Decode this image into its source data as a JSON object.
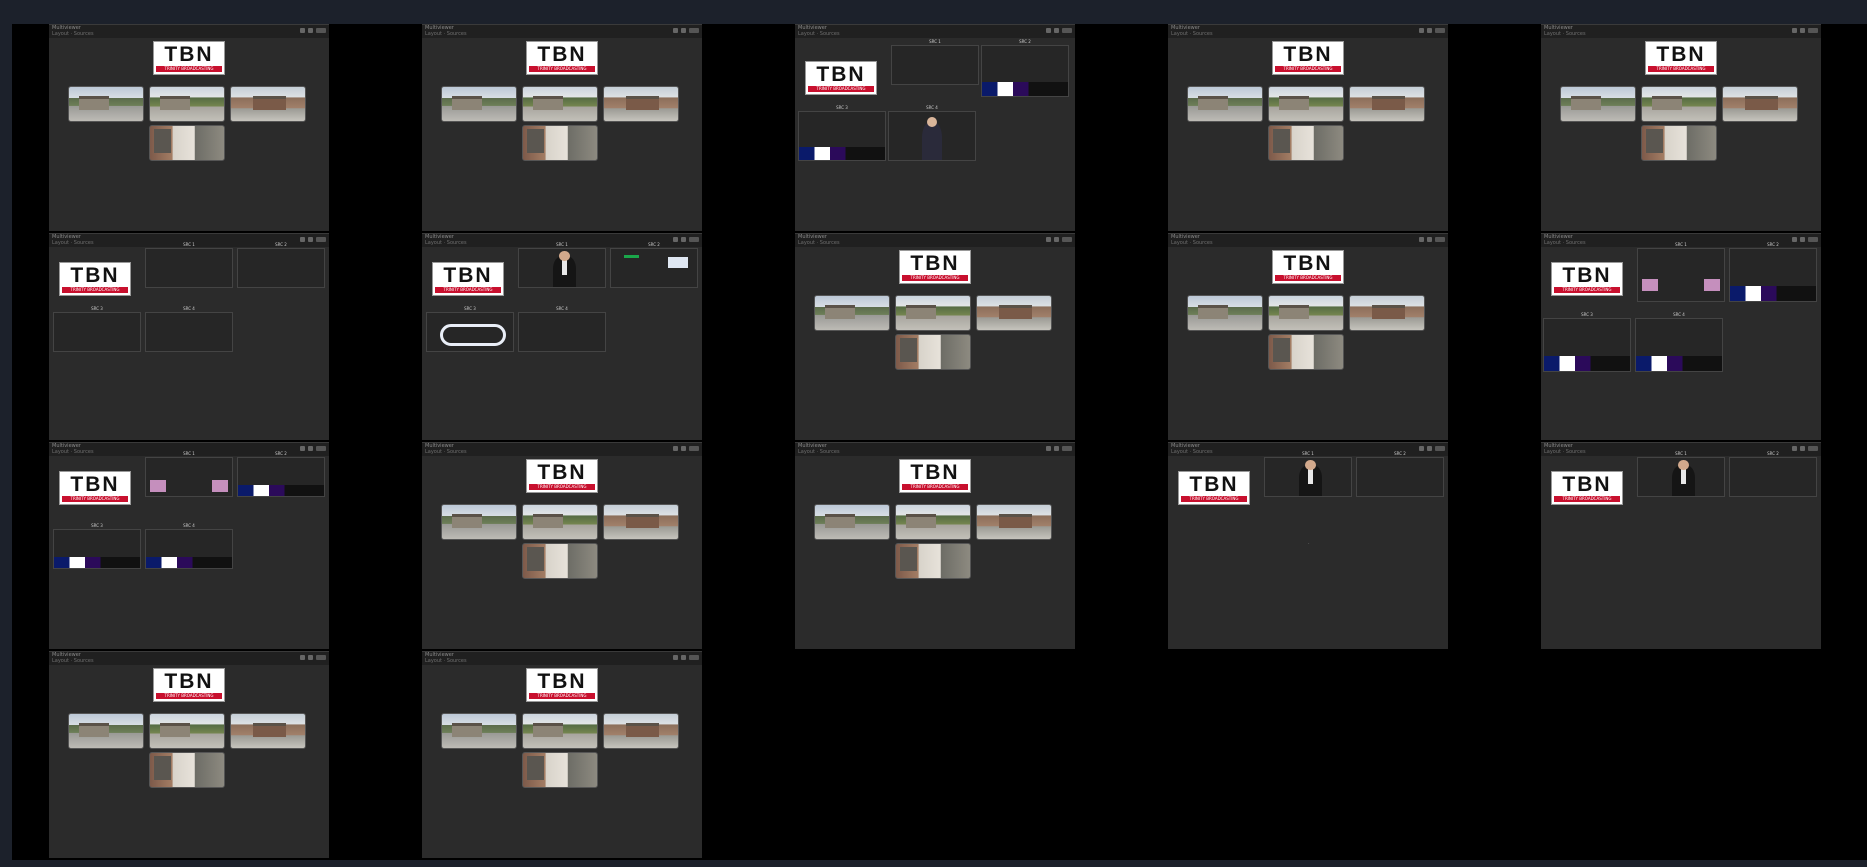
{
  "window": {
    "title": ""
  },
  "panel_header": {
    "title": "Multiviewer",
    "subtitle": "Layout · Sources"
  },
  "logo": {
    "text": "TBN",
    "tagline": "TRINITY BROADCASTING"
  },
  "source_labels": {
    "a": "SRC 1",
    "b": "SRC 2",
    "c": "SRC 3",
    "d": "SRC 4"
  },
  "colors": {
    "page_bg": "#1c212b",
    "stage_bg": "#000000",
    "panel_bg": "#2b2b2b",
    "logo_red": "#c8102e"
  },
  "icons": [
    "tbn-logo",
    "camera-thumbnail",
    "color-bars",
    "studio-feed"
  ]
}
